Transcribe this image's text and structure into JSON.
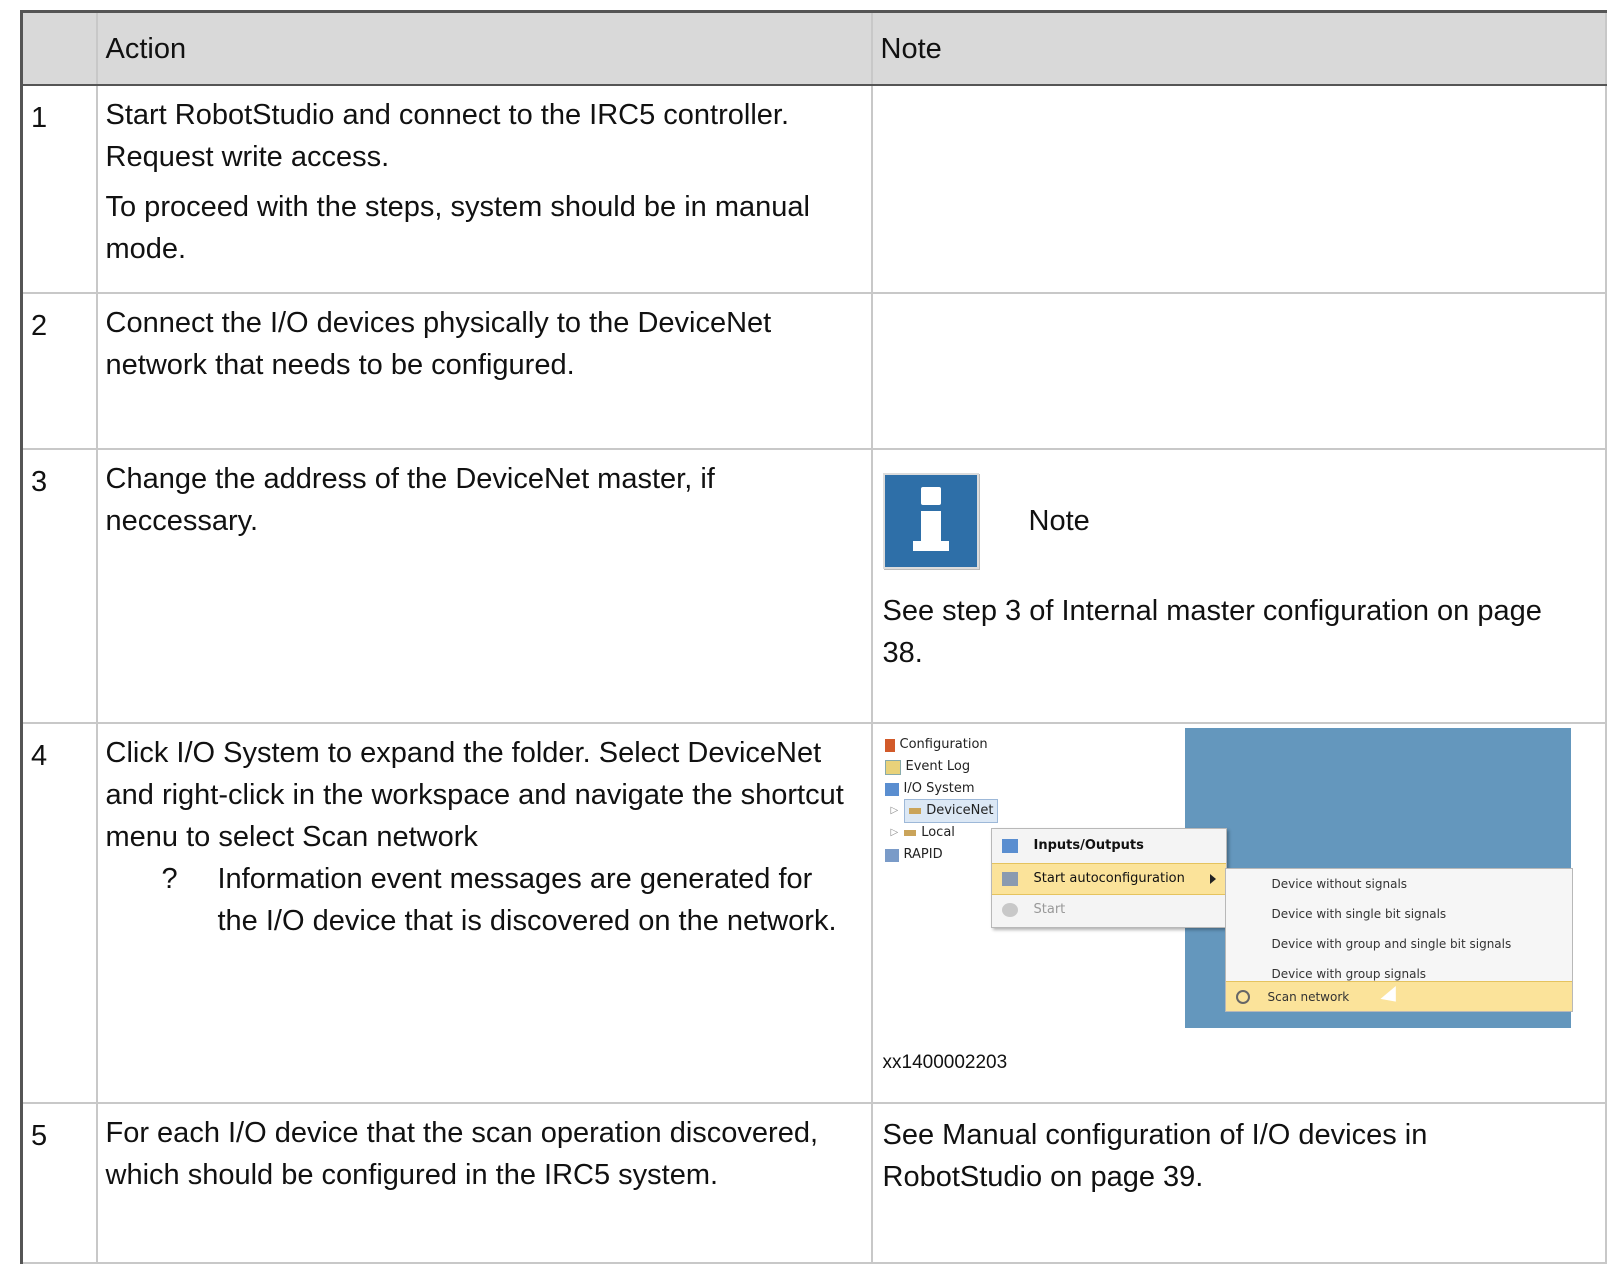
{
  "table": {
    "headers": {
      "num": "",
      "action": "Action",
      "note": "Note"
    },
    "rows": [
      {
        "num": "1",
        "action": [
          "Start RobotStudio and connect to the IRC5 controller. Request write access.",
          "To proceed with the steps, system should be in manual mode."
        ],
        "note": ""
      },
      {
        "num": "2",
        "action": [
          "Connect the I/O devices physically to the DeviceNet network that needs to be configured."
        ],
        "note": ""
      },
      {
        "num": "3",
        "action": [
          "Change the address of the DeviceNet master, if neccessary."
        ],
        "note_heading": "Note",
        "note": "See step 3 of Internal master configuration on page 38."
      },
      {
        "num": "4",
        "action": [
          "Click I/O System to expand the folder. Select DeviceNet and right-click in the workspace and navigate the shortcut menu to select Scan network"
        ],
        "bullet_mark": "?",
        "bullet": "Information event messages are generated for the I/O device that is discovered on the network.",
        "figure_id": "xx1400002203"
      },
      {
        "num": "5",
        "action": [
          "For each I/O device that the scan operation discovered, which should be configured in the IRC5 system."
        ],
        "note": "See Manual configuration of I/O devices in RobotStudio on page 39."
      }
    ]
  },
  "screenshot": {
    "tree": [
      "Configuration",
      "Event Log",
      "I/O System",
      "DeviceNet",
      "Local",
      "RAPID"
    ],
    "context_menu": [
      "Inputs/Outputs",
      "Start autoconfiguration",
      "Start"
    ],
    "submenu": [
      "Device without signals",
      "Device with single bit signals",
      "Device with group and single bit signals",
      "Device with group signals",
      "Scan network"
    ],
    "colors": {
      "workspace": "#6497bd",
      "highlight": "#fbe39a",
      "info_icon": "#2e6fa8"
    }
  }
}
